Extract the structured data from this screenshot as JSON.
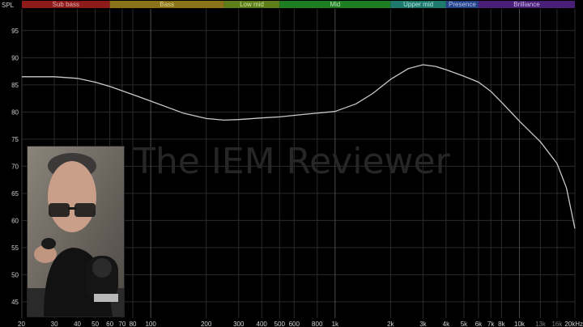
{
  "chart_data": {
    "type": "line",
    "ylabel": "SPL",
    "xscale": "log",
    "xlim": [
      20,
      20000
    ],
    "ylim": [
      42,
      99
    ],
    "yticks": [
      45,
      50,
      55,
      60,
      65,
      70,
      75,
      80,
      85,
      90,
      95
    ],
    "xticks": [
      {
        "v": 20,
        "label": "20"
      },
      {
        "v": 30,
        "label": "30"
      },
      {
        "v": 40,
        "label": "40"
      },
      {
        "v": 50,
        "label": "50"
      },
      {
        "v": 60,
        "label": "60"
      },
      {
        "v": 70,
        "label": "70"
      },
      {
        "v": 80,
        "label": "80"
      },
      {
        "v": 100,
        "label": "100"
      },
      {
        "v": 200,
        "label": "200"
      },
      {
        "v": 300,
        "label": "300"
      },
      {
        "v": 400,
        "label": "400"
      },
      {
        "v": 500,
        "label": "500"
      },
      {
        "v": 600,
        "label": "600"
      },
      {
        "v": 800,
        "label": "800"
      },
      {
        "v": 1000,
        "label": "1k"
      },
      {
        "v": 2000,
        "label": "2k"
      },
      {
        "v": 3000,
        "label": "3k"
      },
      {
        "v": 4000,
        "label": "4k"
      },
      {
        "v": 5000,
        "label": "5k"
      },
      {
        "v": 6000,
        "label": "6k"
      },
      {
        "v": 7000,
        "label": "7k"
      },
      {
        "v": 8000,
        "label": "8k"
      },
      {
        "v": 10000,
        "label": "10k"
      },
      {
        "v": 13000,
        "label": "13k",
        "dim": true
      },
      {
        "v": 16000,
        "label": "16k",
        "dim": true
      },
      {
        "v": 20000,
        "label": "20kHz"
      }
    ],
    "bands": [
      {
        "name": "Sub bass",
        "from": 20,
        "to": 60,
        "color": "#8f1a1a",
        "text": "#e0b0b0"
      },
      {
        "name": "Bass",
        "from": 60,
        "to": 250,
        "color": "#8a7318",
        "text": "#e4d69a"
      },
      {
        "name": "Low mid",
        "from": 250,
        "to": 500,
        "color": "#5d7e1b",
        "text": "#cfe0a0"
      },
      {
        "name": "Mid",
        "from": 500,
        "to": 2000,
        "color": "#1f7e22",
        "text": "#b5e0b5"
      },
      {
        "name": "Upper mid",
        "from": 2000,
        "to": 4000,
        "color": "#1f7a6e",
        "text": "#b0e2dc"
      },
      {
        "name": "Presence",
        "from": 4000,
        "to": 6000,
        "color": "#26438a",
        "text": "#b4c4ec"
      },
      {
        "name": "Brilliance",
        "from": 6000,
        "to": 20000,
        "color": "#4a1f78",
        "text": "#d3bfee"
      }
    ],
    "series": [
      {
        "color": "#c8c8c8",
        "points": [
          [
            20,
            86.5
          ],
          [
            30,
            86.5
          ],
          [
            40,
            86.2
          ],
          [
            50,
            85.5
          ],
          [
            60,
            84.7
          ],
          [
            80,
            83.2
          ],
          [
            100,
            82.0
          ],
          [
            150,
            79.8
          ],
          [
            200,
            78.8
          ],
          [
            250,
            78.5
          ],
          [
            300,
            78.6
          ],
          [
            400,
            78.9
          ],
          [
            500,
            79.1
          ],
          [
            700,
            79.6
          ],
          [
            1000,
            80.1
          ],
          [
            1300,
            81.5
          ],
          [
            1600,
            83.4
          ],
          [
            2000,
            86.0
          ],
          [
            2500,
            88.0
          ],
          [
            3000,
            88.7
          ],
          [
            3500,
            88.4
          ],
          [
            4000,
            87.8
          ],
          [
            5000,
            86.6
          ],
          [
            6000,
            85.5
          ],
          [
            7000,
            83.8
          ],
          [
            8000,
            81.8
          ],
          [
            10000,
            78.3
          ],
          [
            13000,
            74.5
          ],
          [
            16000,
            70.5
          ],
          [
            18000,
            66.0
          ],
          [
            20000,
            58.5
          ]
        ]
      }
    ],
    "watermark": "The IEM Reviewer"
  },
  "webcam": {
    "subject": "presenter holding earphone in front of microphone"
  }
}
